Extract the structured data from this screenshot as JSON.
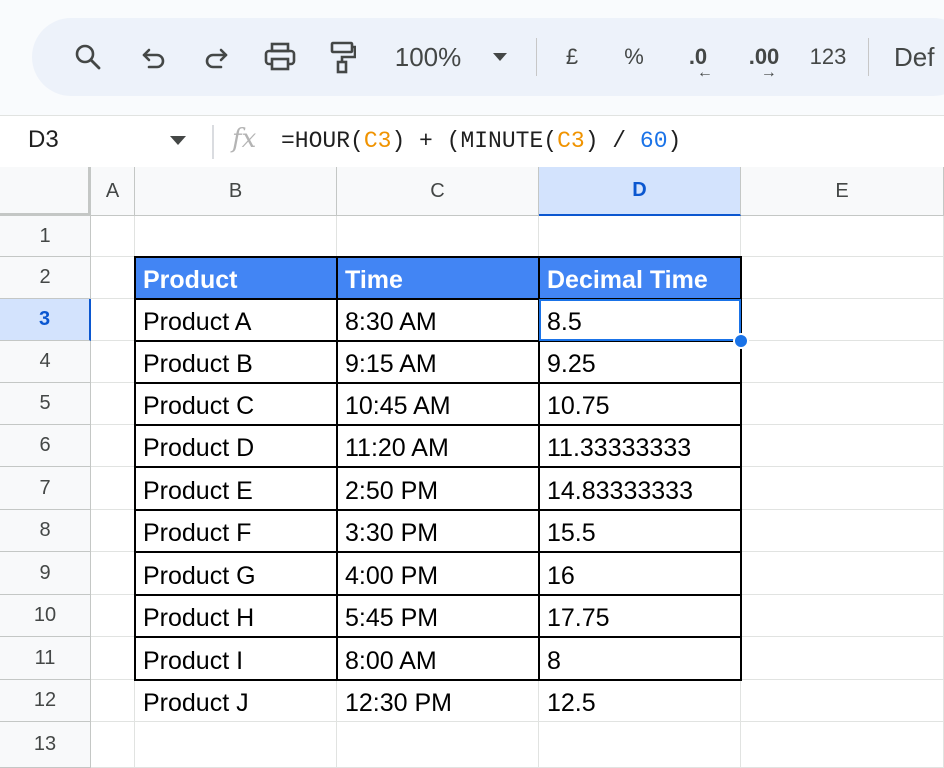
{
  "toolbar": {
    "icons": [
      "search-icon",
      "undo-icon",
      "redo-icon",
      "print-icon",
      "paint-format-icon"
    ],
    "zoom": "100%",
    "currency": "£",
    "percent": "%",
    "decrease_decimal": ".0",
    "increase_decimal": ".00",
    "number_format": "123",
    "font": "Def"
  },
  "formula_bar": {
    "name_box": "D3",
    "fx": "fx",
    "formula_parts": [
      "=HOUR(",
      "C3",
      ") + (MINUTE(",
      "C3",
      ") / ",
      "60",
      ")"
    ]
  },
  "sheet": {
    "columns": [
      "A",
      "B",
      "C",
      "D",
      "E"
    ],
    "selected_column": "D",
    "rows": [
      "1",
      "2",
      "3",
      "4",
      "5",
      "6",
      "7",
      "8",
      "9",
      "10",
      "11",
      "12",
      "13"
    ],
    "selected_row": "3",
    "selected_cell": "D3",
    "header_color": "#4285f4",
    "selection_color": "#1a73e8",
    "table": {
      "headers": [
        "Product",
        "Time",
        "Decimal Time"
      ],
      "rows": [
        [
          "Product A",
          "8:30 AM",
          "8.5"
        ],
        [
          "Product B",
          "9:15 AM",
          "9.25"
        ],
        [
          "Product C",
          "10:45 AM",
          "10.75"
        ],
        [
          "Product D",
          "11:20 AM",
          "11.33333333"
        ],
        [
          "Product E",
          "2:50 PM",
          "14.83333333"
        ],
        [
          "Product F",
          "3:30 PM",
          "15.5"
        ],
        [
          "Product G",
          "4:00 PM",
          "16"
        ],
        [
          "Product H",
          "5:45 PM",
          "17.75"
        ],
        [
          "Product I",
          "8:00 AM",
          "8"
        ],
        [
          "Product J",
          "12:30 PM",
          "12.5"
        ]
      ]
    }
  }
}
